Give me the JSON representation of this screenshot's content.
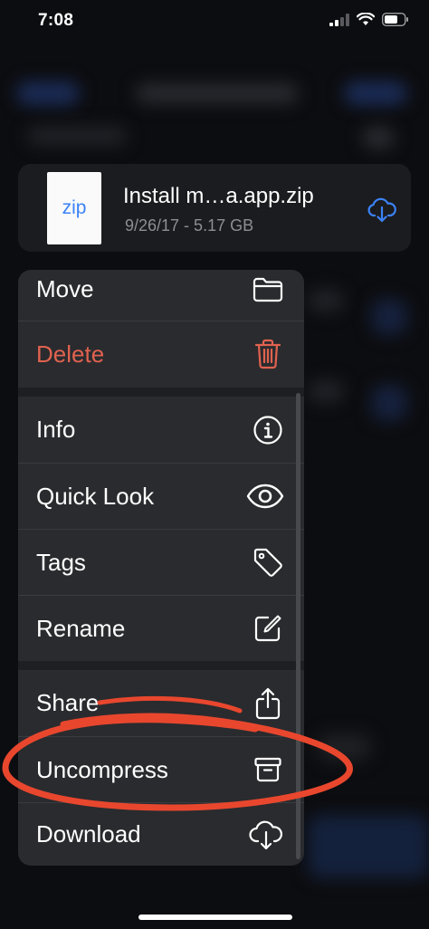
{
  "status_bar": {
    "time": "7:08"
  },
  "file": {
    "thumb_label": "zip",
    "name": "Install m…a.app.zip",
    "meta": "9/26/17 - 5.17 GB"
  },
  "menu": {
    "move": "Move",
    "delete": "Delete",
    "info": "Info",
    "quick_look": "Quick Look",
    "tags": "Tags",
    "rename": "Rename",
    "share": "Share",
    "uncompress": "Uncompress",
    "download": "Download"
  },
  "colors": {
    "delete_red": "#e0624f",
    "annotation_red": "#e8472e",
    "accent_blue": "#3b82f6"
  },
  "icons": {
    "move": "folder-icon",
    "delete": "trash-icon",
    "info": "info-icon",
    "quick_look": "eye-icon",
    "tags": "tag-icon",
    "rename": "edit-icon",
    "share": "share-icon",
    "uncompress": "archive-icon",
    "download": "cloud-download-icon"
  }
}
